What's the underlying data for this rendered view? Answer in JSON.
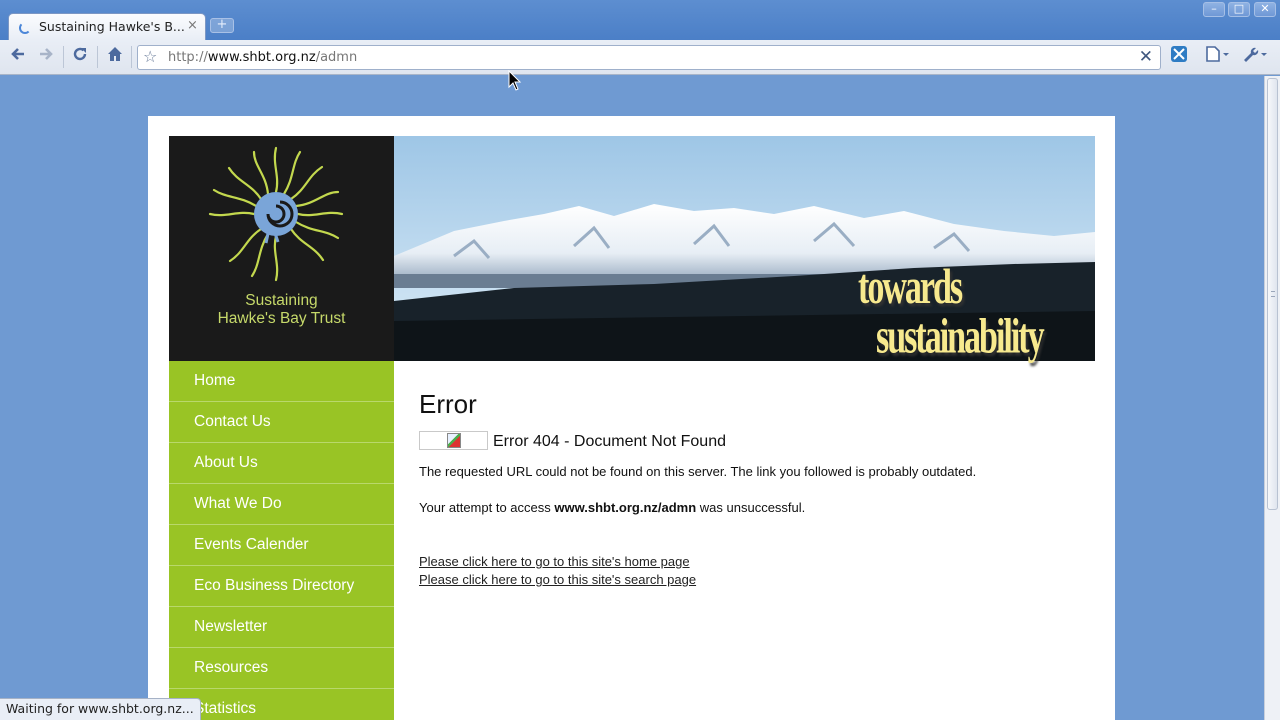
{
  "browser": {
    "tab_title": "Sustaining Hawke's B...",
    "tab_close": "×",
    "new_tab": "+",
    "window_buttons": [
      "–",
      "□",
      "✕"
    ],
    "url_scheme": "http://",
    "url_host": "www.shbt.org.nz",
    "url_path": "/admn",
    "stop_glyph": "✕",
    "status_text": "Waiting for www.shbt.org.nz...",
    "icons": [
      "back-icon",
      "forward-icon",
      "reload-icon",
      "home-icon",
      "star-icon",
      "stop-icon",
      "extension-icon",
      "page-menu-icon",
      "wrench-icon"
    ]
  },
  "site": {
    "logo_line1": "Sustaining",
    "logo_line2": "Hawke's Bay Trust",
    "tagline_1": "towards",
    "tagline_2": "sustainability",
    "nav": [
      "Home",
      "Contact Us",
      "About Us",
      "What We Do",
      "Events Calender",
      "Eco Business Directory",
      "Newsletter",
      "Resources",
      "Statistics"
    ],
    "accent_color": "#99c425",
    "logo_bg_color": "#1a1a1a"
  },
  "error": {
    "heading": "Error",
    "title": "Error 404 - Document Not Found",
    "message": "The requested URL could not be found on this server. The link you followed is probably outdated.",
    "attempt_prefix": "Your attempt to access ",
    "attempt_url": "www.shbt.org.nz/admn",
    "attempt_suffix": " was unsuccessful.",
    "link_home": "Please click here to go to this site's home page",
    "link_search": "Please click here to go to this site's search page"
  }
}
